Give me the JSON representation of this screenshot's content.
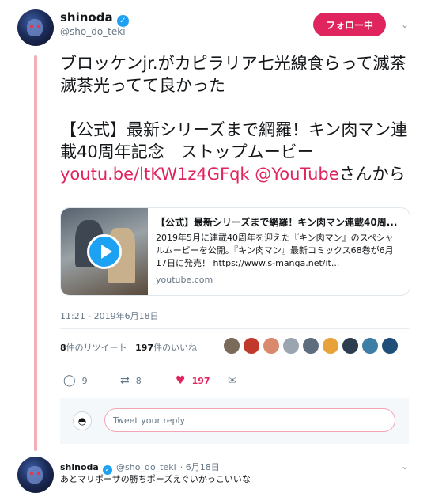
{
  "tweet": {
    "author_name": "shinoda",
    "author_handle": "@sho_do_teki",
    "follow_label": "フォロー中",
    "text_line1": "ブロッケンjr.がカピラリア七光線食らって滅茶滅茶光ってて良かった",
    "text_line2": "【公式】最新シリーズまで網羅！キン肉マン連載40周年記念　ストップムービー",
    "link_url": "youtu.be/ltKW1z4GFqk",
    "link_mention": "@YouTube",
    "text_suffix": "さんから",
    "card": {
      "title": "【公式】最新シリーズまで網羅！キン肉マン連載40周...",
      "description": "2019年5月に連載40周年を迎えた『キン肉マン』のスペシャルムービーを公開。『キン肉マン』最新コミックス68巻が6月17日に発売！ https://www.s-manga.net/it...",
      "domain": "youtube.com"
    },
    "timestamp": "11:21 - 2019年6月18日",
    "retweets_count": "8",
    "retweets_label": "件のリツイート",
    "likes_count": "197",
    "likes_label": "件のいいね",
    "actions": {
      "reply_count": "9",
      "retweet_count": "8",
      "like_count": "197"
    },
    "liker_colors": [
      "#7a6a5a",
      "#c0392b",
      "#d98a6c",
      "#9aa5b1",
      "#5d6d7e",
      "#e8a23a",
      "#2c3e50",
      "#3d7ea6",
      "#1f4e79"
    ]
  },
  "reply_box": {
    "placeholder": "Tweet your reply"
  },
  "reply": {
    "author_name": "shinoda",
    "author_handle": "@sho_do_teki",
    "date": "· 6月18日",
    "text": "あとマリポーサの勝ちポーズえぐいかっこいいな"
  },
  "colors": {
    "accent": "#e0245e",
    "verified": "#1da1f2",
    "thread_line": "#f4aeb7"
  }
}
